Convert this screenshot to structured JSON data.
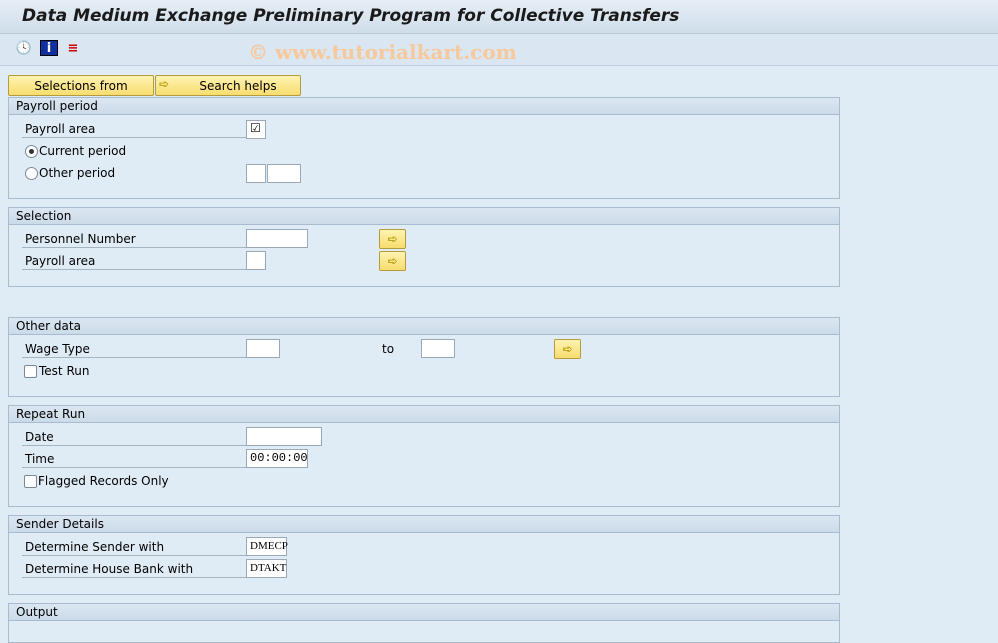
{
  "window": {
    "title": "Data Medium Exchange Preliminary Program for Collective Transfers"
  },
  "toolbar": {
    "icons": [
      "execute-icon",
      "info-icon",
      "variant-icon"
    ]
  },
  "watermark": "© www.tutorialkart.com",
  "buttons": {
    "selections_from": "Selections from",
    "search_helps": "Search helps"
  },
  "payroll_period": {
    "title": "Payroll period",
    "payroll_area": "Payroll area",
    "payroll_area_checked": true,
    "current_period": "Current period",
    "other_period": "Other period",
    "selected": "current_period",
    "other_period_value1": "",
    "other_period_value2": ""
  },
  "selection": {
    "title": "Selection",
    "personnel_number": "Personnel Number",
    "personnel_number_value": "",
    "payroll_area": "Payroll area",
    "payroll_area_value": ""
  },
  "other_data": {
    "title": "Other data",
    "wage_type": "Wage Type",
    "wage_type_from": "",
    "to": "to",
    "wage_type_to": "",
    "test_run": "Test Run",
    "test_run_checked": false
  },
  "repeat_run": {
    "title": "Repeat Run",
    "date": "Date",
    "date_value": "",
    "time": "Time",
    "time_value": "00:00:00",
    "flagged": "Flagged Records Only",
    "flagged_checked": false
  },
  "sender_details": {
    "title": "Sender Details",
    "determine_sender": "Determine Sender with",
    "determine_sender_value": "DMECP",
    "determine_house_bank": "Determine House Bank with",
    "determine_house_bank_value": "DTAKT"
  },
  "output": {
    "title": "Output"
  }
}
